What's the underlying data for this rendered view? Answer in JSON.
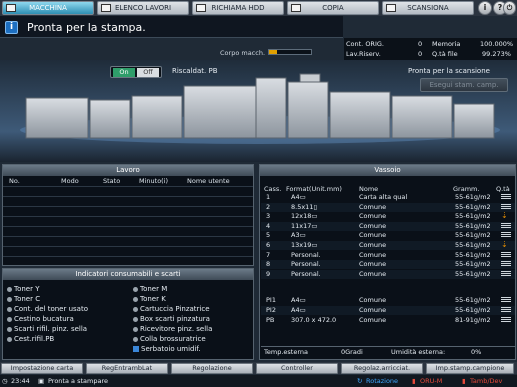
{
  "tabs": [
    {
      "label": "MACCHINA",
      "icon": "machine-icon",
      "active": true
    },
    {
      "label": "ELENCO LAVORI",
      "icon": "job-list-icon",
      "active": false
    },
    {
      "label": "RICHIAMA HDD",
      "icon": "hdd-icon",
      "active": false
    },
    {
      "label": "COPIA",
      "icon": "copy-icon",
      "active": false
    },
    {
      "label": "SCANSIONA",
      "icon": "scan-icon",
      "active": false
    }
  ],
  "header_buttons": {
    "info": "i",
    "help": "?",
    "power": "⏻"
  },
  "message": {
    "text": "Pronta per la stampa."
  },
  "corpo": {
    "label": "Corpo macch.",
    "level": 0.2
  },
  "counters": {
    "cont_orig_label": "Cont. ORIG.",
    "cont_orig_value": "0",
    "lav_riserv_label": "Lav.Riserv.",
    "lav_riserv_value": "0",
    "memoria_label": "Memoria",
    "memoria_value": "100.000%",
    "qta_file_label": "Q.tà file",
    "qta_file_value": "99.273%"
  },
  "heater": {
    "on": "On",
    "off": "Off",
    "label": "Riscaldat. PB"
  },
  "scan": {
    "status": "Pronta per la scansione",
    "button": "Esegui stam. camp."
  },
  "lavoro": {
    "title": "Lavoro",
    "headers": [
      "No.",
      "Modo",
      "Stato",
      "Minuto(i)",
      "Nome utente"
    ]
  },
  "consumabili": {
    "title": "Indicatori consumabili e scarti",
    "left": [
      "Toner Y",
      "Toner C",
      "Cont. del toner usato",
      "Cestino bucatura",
      "Scarti rifil. pinz. sella",
      "Cest.rifil.PB"
    ],
    "right": [
      "Toner M",
      "Toner K",
      "Cartuccia Pinzatrice",
      "Box scarti pinzatura",
      "Ricevitore pinz. sella",
      "Colla brossuratrice",
      "Serbatoio umidif."
    ]
  },
  "vassoio": {
    "title": "Vassoio",
    "headers": {
      "cass": "Cass.",
      "format": "Format(Unit.mm)",
      "nome": "Nome",
      "gramm": "Gramm.",
      "qta": "Q.tà"
    },
    "rows": [
      {
        "cass": "1",
        "format": "A4▭",
        "nome": "Carta alta qual",
        "gramm": "55-61g/m2",
        "level": "high"
      },
      {
        "cass": "2",
        "format": "8.5x11▯",
        "nome": "Comune",
        "gramm": "55-61g/m2",
        "level": "high"
      },
      {
        "cass": "3",
        "format": "12x18▭",
        "nome": "Comune",
        "gramm": "55-61g/m2",
        "level": "low"
      },
      {
        "cass": "4",
        "format": "11x17▭",
        "nome": "Comune",
        "gramm": "55-61g/m2",
        "level": "high"
      },
      {
        "cass": "5",
        "format": "A3▭",
        "nome": "Comune",
        "gramm": "55-61g/m2",
        "level": "high"
      },
      {
        "cass": "6",
        "format": "13x19▭",
        "nome": "Comune",
        "gramm": "55-61g/m2",
        "level": "low"
      },
      {
        "cass": "7",
        "format": "Personal.",
        "nome": "Comune",
        "gramm": "55-61g/m2",
        "level": "high"
      },
      {
        "cass": "8",
        "format": "Personal.",
        "nome": "Comune",
        "gramm": "55-61g/m2",
        "level": "high"
      },
      {
        "cass": "9",
        "format": "Personal.",
        "nome": "Comune",
        "gramm": "55-61g/m2",
        "level": "high"
      }
    ],
    "extra_rows": [
      {
        "cass": "PI1",
        "format": "A4▭",
        "nome": "Comune",
        "gramm": "55-61g/m2"
      },
      {
        "cass": "PI2",
        "format": "A4▭",
        "nome": "Comune",
        "gramm": "55-61g/m2"
      },
      {
        "cass": "PB",
        "format": "307.0 x 472.0",
        "nome": "Comune",
        "gramm": "81-91g/m2"
      }
    ],
    "temp_label": "Temp.esterna",
    "temp_value": "0Gradi",
    "umid_label": "Umidità esterna:",
    "umid_value": "0%"
  },
  "bottom_buttons": [
    "Impostazione carta",
    "RegEntrambLat",
    "Regolazione",
    "Controller",
    "Regolaz.arricciat.",
    "Imp.stamp.campione"
  ],
  "status": {
    "time": "23:44",
    "text": "Pronta a stampare",
    "rotazione": "Rotazione",
    "oru": "ORU-M",
    "tamb": "Tamb/Dev"
  },
  "colors": {
    "accent": "#2e8fb4",
    "warning": "#e08a00",
    "panel": "#0a1018"
  }
}
